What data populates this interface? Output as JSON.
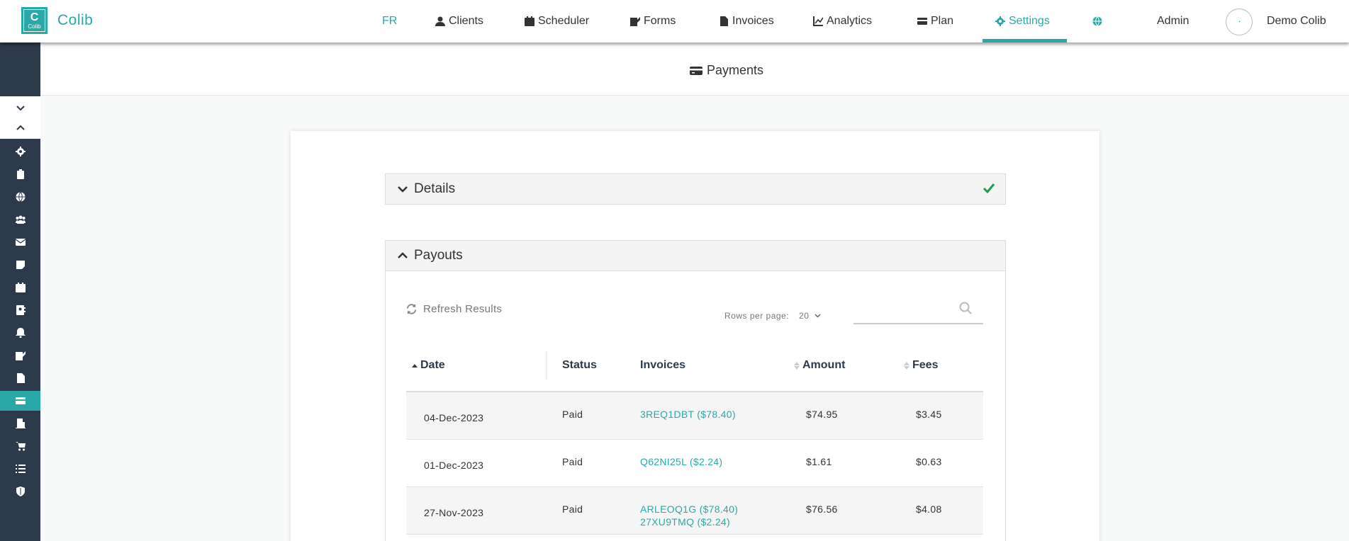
{
  "brand": {
    "logo_letter": "C",
    "logo_small": "Colib",
    "name": "Colib"
  },
  "nav": {
    "lang": "FR",
    "clients": "Clients",
    "scheduler": "Scheduler",
    "forms": "Forms",
    "invoices": "Invoices",
    "analytics": "Analytics",
    "plan": "Plan",
    "settings": "Settings",
    "admin": "Admin",
    "user": "Demo Colib",
    "accent": "#2aa8a8"
  },
  "page": {
    "title": "Payments"
  },
  "details": {
    "title": "Details"
  },
  "payouts": {
    "title": "Payouts",
    "refresh_label": "Refresh Results",
    "rows_per_page_label": "Rows per page:",
    "rows_per_page_value": "20",
    "search_value": "",
    "columns": {
      "date": "Date",
      "status": "Status",
      "invoices": "Invoices",
      "amount": "Amount",
      "fees": "Fees"
    },
    "rows": [
      {
        "date": "04-Dec-2023",
        "status": "Paid",
        "invoices": [
          "3REQ1DBT ($78.40)"
        ],
        "amount": "$74.95",
        "fees": "$3.45"
      },
      {
        "date": "01-Dec-2023",
        "status": "Paid",
        "invoices": [
          "Q62NI25L ($2.24)"
        ],
        "amount": "$1.61",
        "fees": "$0.63"
      },
      {
        "date": "27-Nov-2023",
        "status": "Paid",
        "invoices": [
          "ARLEOQ1G ($78.40)",
          "27XU9TMQ ($2.24)"
        ],
        "amount": "$76.56",
        "fees": "$4.08"
      }
    ]
  }
}
